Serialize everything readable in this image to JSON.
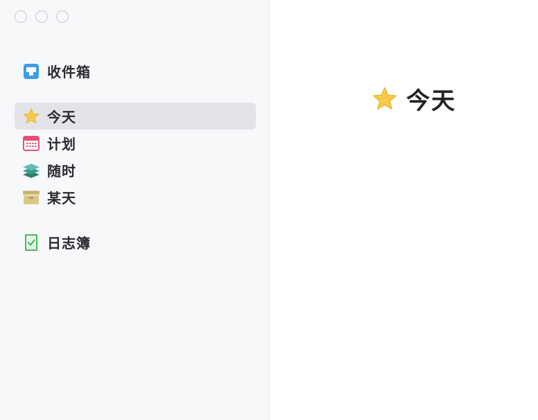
{
  "window": {
    "controls": [
      "close",
      "minimize",
      "zoom"
    ]
  },
  "sidebar": {
    "items": [
      {
        "id": "inbox",
        "label": "收件箱",
        "icon": "inbox-icon",
        "color": "#3c9be8",
        "selected": false
      },
      {
        "id": "today",
        "label": "今天",
        "icon": "star-icon",
        "color": "#f7c948",
        "selected": true
      },
      {
        "id": "upcoming",
        "label": "计划",
        "icon": "calendar-icon",
        "color": "#e84f78",
        "selected": false
      },
      {
        "id": "anytime",
        "label": "随时",
        "icon": "layers-icon",
        "color": "#3e9c8f",
        "selected": false
      },
      {
        "id": "someday",
        "label": "某天",
        "icon": "archive-box-icon",
        "color": "#cdb872",
        "selected": false
      },
      {
        "id": "logbook",
        "label": "日志簿",
        "icon": "logbook-icon",
        "color": "#48b85a",
        "selected": false
      }
    ]
  },
  "main": {
    "title": "今天",
    "title_icon": "star-icon"
  },
  "colors": {
    "sidebar_bg": "#f7f8fa",
    "selected_bg": "#e3e4e7",
    "text": "#2a2b2e"
  }
}
